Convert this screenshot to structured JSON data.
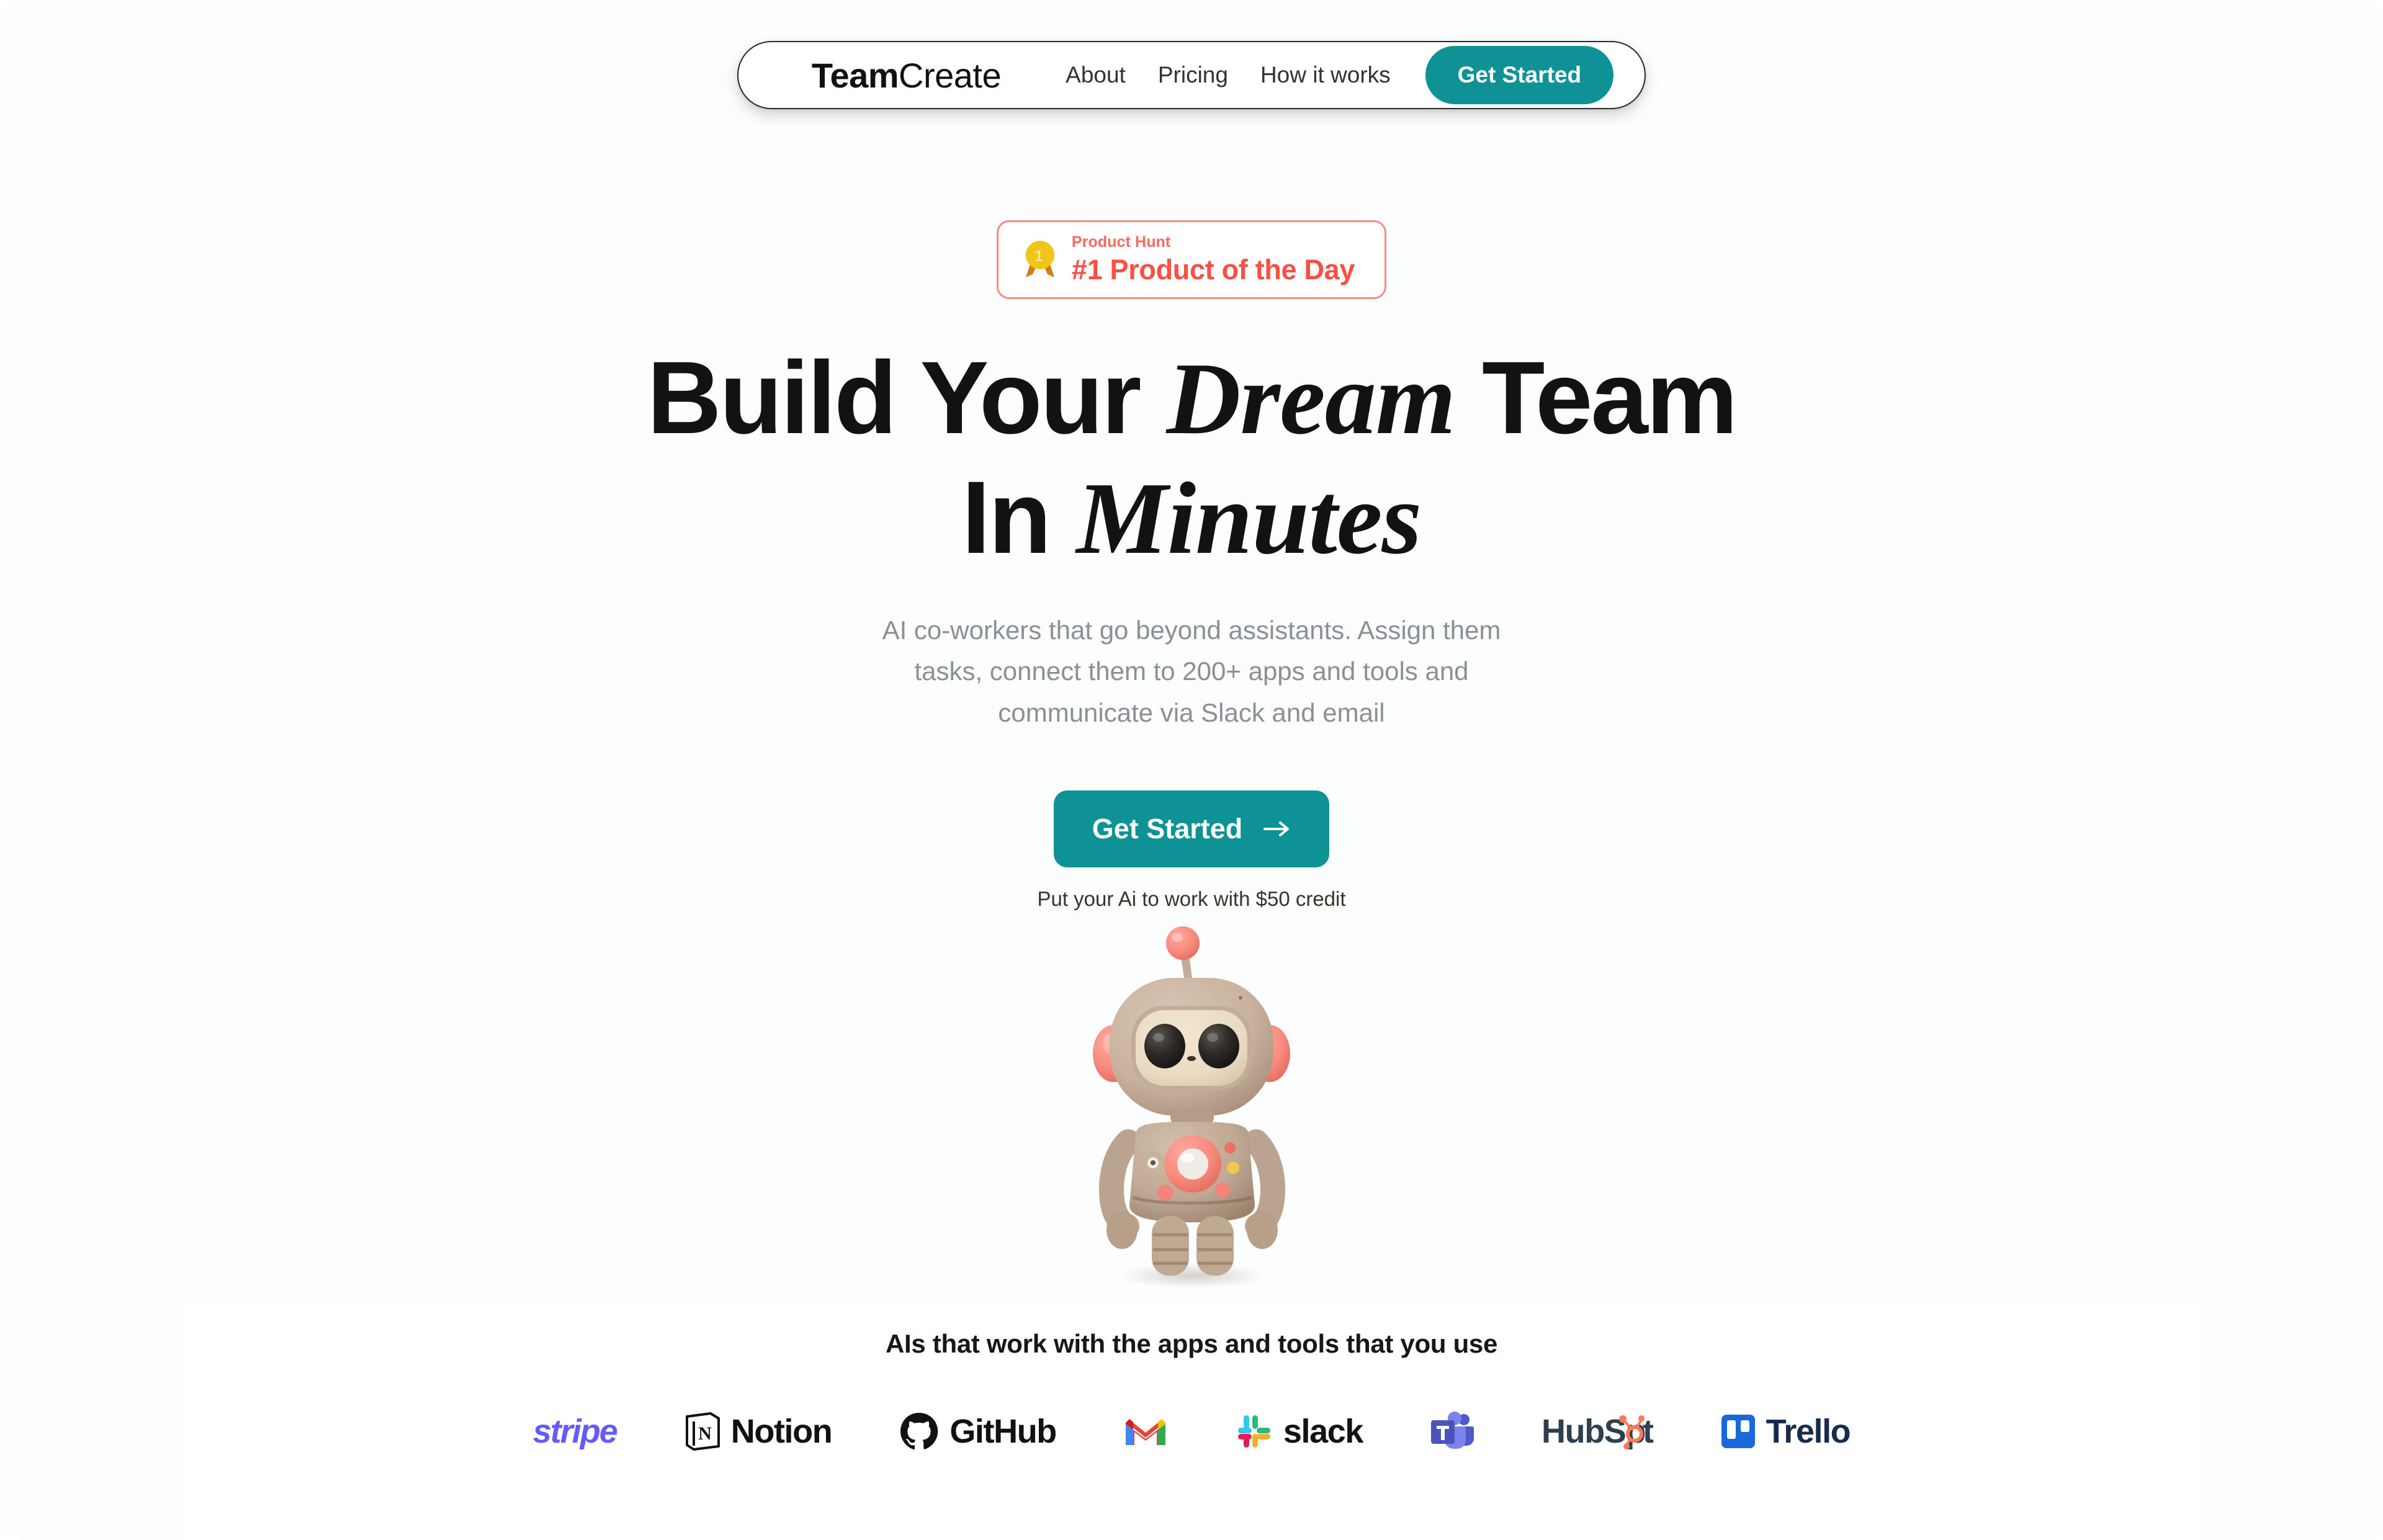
{
  "nav": {
    "brand_strong": "Team",
    "brand_light": "Create",
    "links": [
      {
        "label": "About"
      },
      {
        "label": "Pricing"
      },
      {
        "label": "How it works"
      }
    ],
    "cta_label": "Get Started"
  },
  "badge": {
    "kicker": "Product Hunt",
    "title": "#1 Product of the Day",
    "icon": "gold-medal-icon",
    "border_color": "#ff8a80",
    "title_color": "#fc4f43",
    "kicker_color": "#ff6a5e"
  },
  "hero": {
    "headline_part1": "Build Your ",
    "headline_em1": "Dream",
    "headline_part2": " Team",
    "headline_part3": "In ",
    "headline_em2": "Minutes",
    "subhead": "AI co-workers that go beyond assistants. Assign them tasks, connect them to 200+ apps and tools and communicate via Slack and email",
    "cta_label": "Get Started",
    "cta_arrow": "arrow-right-icon",
    "cta_note": "Put your Ai to work with $50 credit",
    "mascot": "robot-mascot-illustration",
    "accent_color": "#0f9296"
  },
  "logos": {
    "heading": "AIs that work with the apps and tools that you use",
    "items": [
      {
        "name": "stripe",
        "label": "stripe",
        "color": "#635bff",
        "icon": "none"
      },
      {
        "name": "notion",
        "label": "Notion",
        "color": "#111111",
        "icon": "notion-icon"
      },
      {
        "name": "github",
        "label": "GitHub",
        "color": "#111111",
        "icon": "github-icon"
      },
      {
        "name": "gmail",
        "label": "",
        "color": "#ea4335",
        "icon": "gmail-icon"
      },
      {
        "name": "slack",
        "label": "slack",
        "color": "#111111",
        "icon": "slack-icon"
      },
      {
        "name": "microsoft-teams",
        "label": "",
        "color": "#5059c9",
        "icon": "teams-icon"
      },
      {
        "name": "hubspot",
        "label": "HubSpot",
        "color": "#2e3f50",
        "icon": "hubspot-sprocket-icon"
      },
      {
        "name": "trello",
        "label": "Trello",
        "color": "#172b4d",
        "icon": "trello-icon"
      }
    ]
  }
}
